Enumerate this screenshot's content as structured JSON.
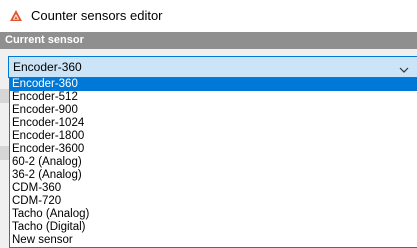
{
  "window": {
    "title": "Counter sensors editor",
    "icon": "app-logo-icon",
    "accent_color": "#e2572f"
  },
  "section": {
    "header": "Current sensor"
  },
  "combo": {
    "value": "Encoder-360",
    "arrow_icon": "chevron-down-icon"
  },
  "dropdown": {
    "selected_index": 0,
    "selection_color": "#0078d7",
    "items": [
      "Encoder-360",
      "Encoder-512",
      "Encoder-900",
      "Encoder-1024",
      "Encoder-1800",
      "Encoder-3600",
      "60-2 (Analog)",
      "36-2 (Analog)",
      "CDM-360",
      "CDM-720",
      "Tacho (Analog)",
      "Tacho (Digital)",
      "New sensor"
    ]
  }
}
